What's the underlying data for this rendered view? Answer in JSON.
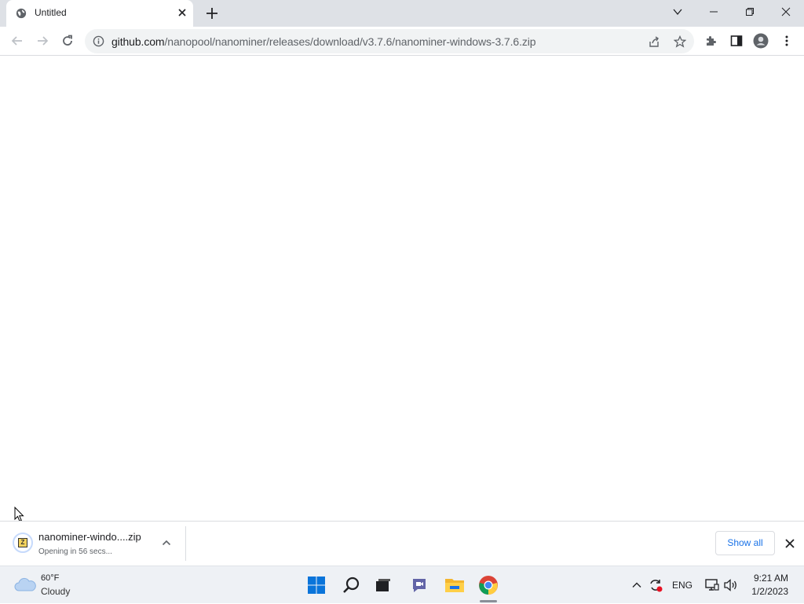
{
  "tab": {
    "title": "Untitled"
  },
  "omnibox": {
    "url_host": "github.com",
    "url_path": "/nanopool/nanominer/releases/download/v3.7.6/nanominer-windows-3.7.6.zip"
  },
  "download": {
    "filename": "nanominer-windo....zip",
    "status": "Opening in 56 secs...",
    "show_all_label": "Show all"
  },
  "taskbar": {
    "weather_temp": "60°F",
    "weather_desc": "Cloudy",
    "language": "ENG",
    "time": "9:21 AM",
    "date": "1/2/2023"
  },
  "colors": {
    "tab_bar_bg": "#dee1e6",
    "accent_blue": "#1a73e8",
    "taskbar_bg": "#eef1f5"
  },
  "icons": {
    "tab_favicon": "globe-icon",
    "back": "back-arrow-icon",
    "forward": "forward-arrow-icon",
    "reload": "reload-icon",
    "info": "info-icon",
    "share": "share-icon",
    "bookmark": "star-icon",
    "extensions": "puzzle-icon",
    "sidepanel": "side-panel-icon",
    "profile": "profile-icon",
    "menu": "kebab-menu-icon"
  }
}
